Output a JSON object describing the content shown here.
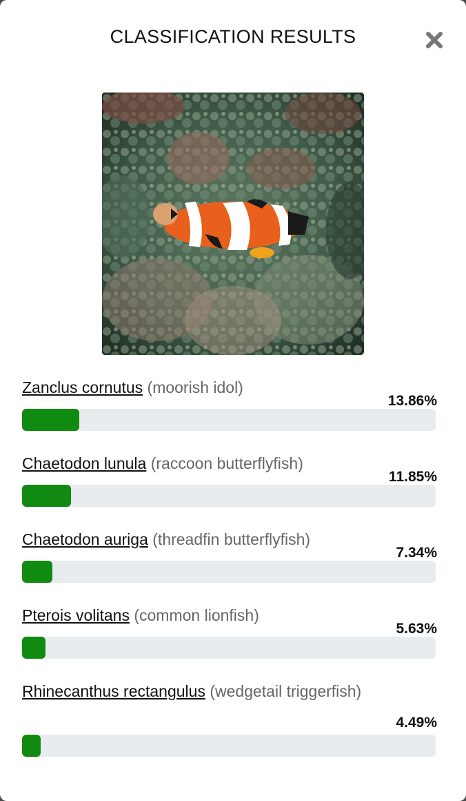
{
  "modal": {
    "title": "CLASSIFICATION RESULTS",
    "close_icon": "close-icon",
    "image_alt": "fish photo"
  },
  "colors": {
    "bar_fill": "#118a11",
    "bar_track": "#e9ecef",
    "common_name": "#666666"
  },
  "results": [
    {
      "scientific": "Zanclus cornutus",
      "common": "(moorish idol)",
      "percent": "13.86%",
      "value": 13.86
    },
    {
      "scientific": "Chaetodon lunula",
      "common": "(raccoon butterflyfish)",
      "percent": "11.85%",
      "value": 11.85
    },
    {
      "scientific": "Chaetodon auriga",
      "common": "(threadfin butterflyfish)",
      "percent": "7.34%",
      "value": 7.34
    },
    {
      "scientific": "Pterois volitans",
      "common": "(common lionfish)",
      "percent": "5.63%",
      "value": 5.63
    },
    {
      "scientific": "Rhinecanthus rectangulus",
      "common": "(wedgetail triggerfish)",
      "percent": "4.49%",
      "value": 4.49
    }
  ]
}
